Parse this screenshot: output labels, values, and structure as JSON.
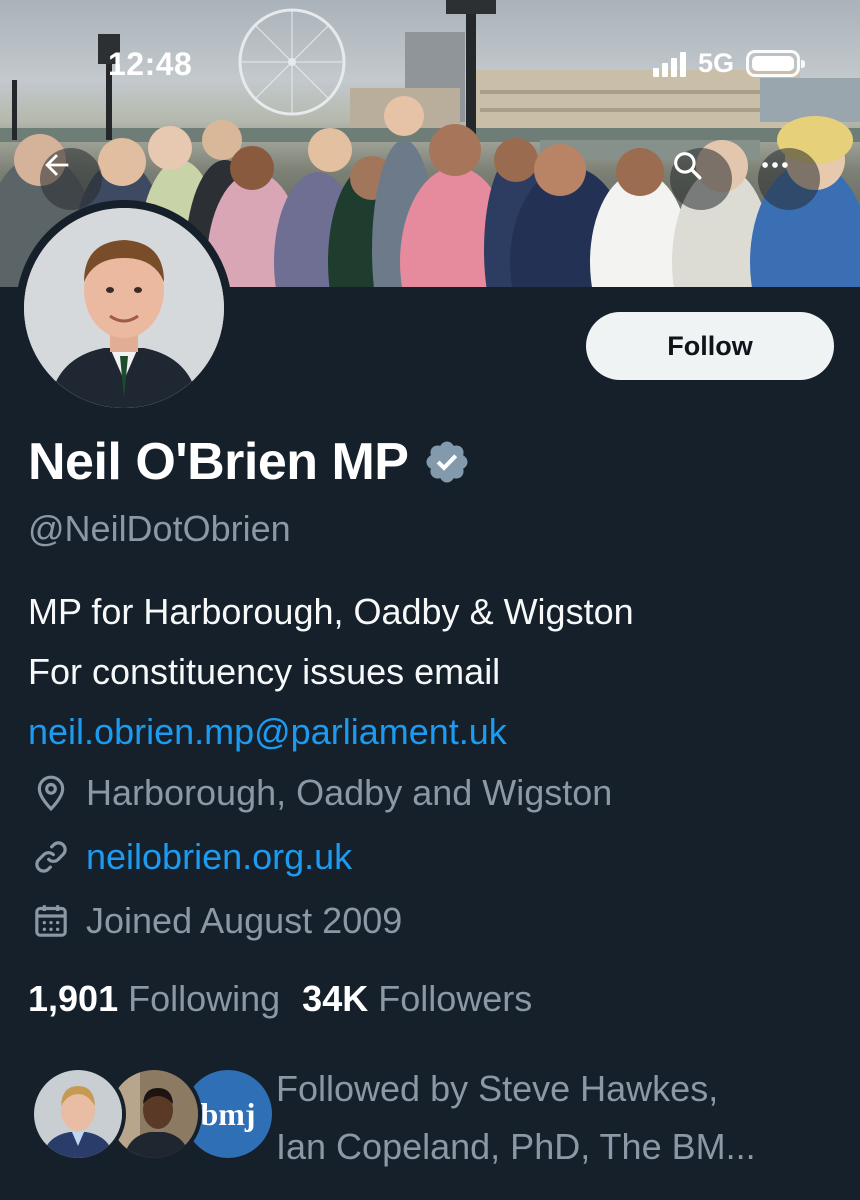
{
  "status_bar": {
    "time": "12:48",
    "network": "5G"
  },
  "header": {
    "back_icon": "arrow-left-icon",
    "search_icon": "search-icon",
    "more_icon": "more-horizontal-icon"
  },
  "profile": {
    "display_name": "Neil O'Brien MP",
    "verified_icon": "verified-badge-icon",
    "handle": "@NeilDotObrien",
    "follow_label": "Follow",
    "bio_line1": "MP for Harborough, Oadby & Wigston",
    "bio_line2": "For constituency issues email",
    "bio_email": "neil.obrien.mp@parliament.uk",
    "location": "Harborough, Oadby and Wigston",
    "website": "neilobrien.org.uk",
    "joined": "Joined August 2009"
  },
  "stats": {
    "following_count": "1,901",
    "following_label": "Following",
    "followers_count": "34K",
    "followers_label": "Followers"
  },
  "followed_by": {
    "line1": "Followed by Steve Hawkes,",
    "line2": "Ian Copeland, PhD, The BM...",
    "third_avatar_text": "bmj"
  },
  "colors": {
    "background": "#15202b",
    "accent_link": "#1d9bf0",
    "secondary_text": "#8b98a5",
    "follow_button_bg": "#eff3f4"
  }
}
